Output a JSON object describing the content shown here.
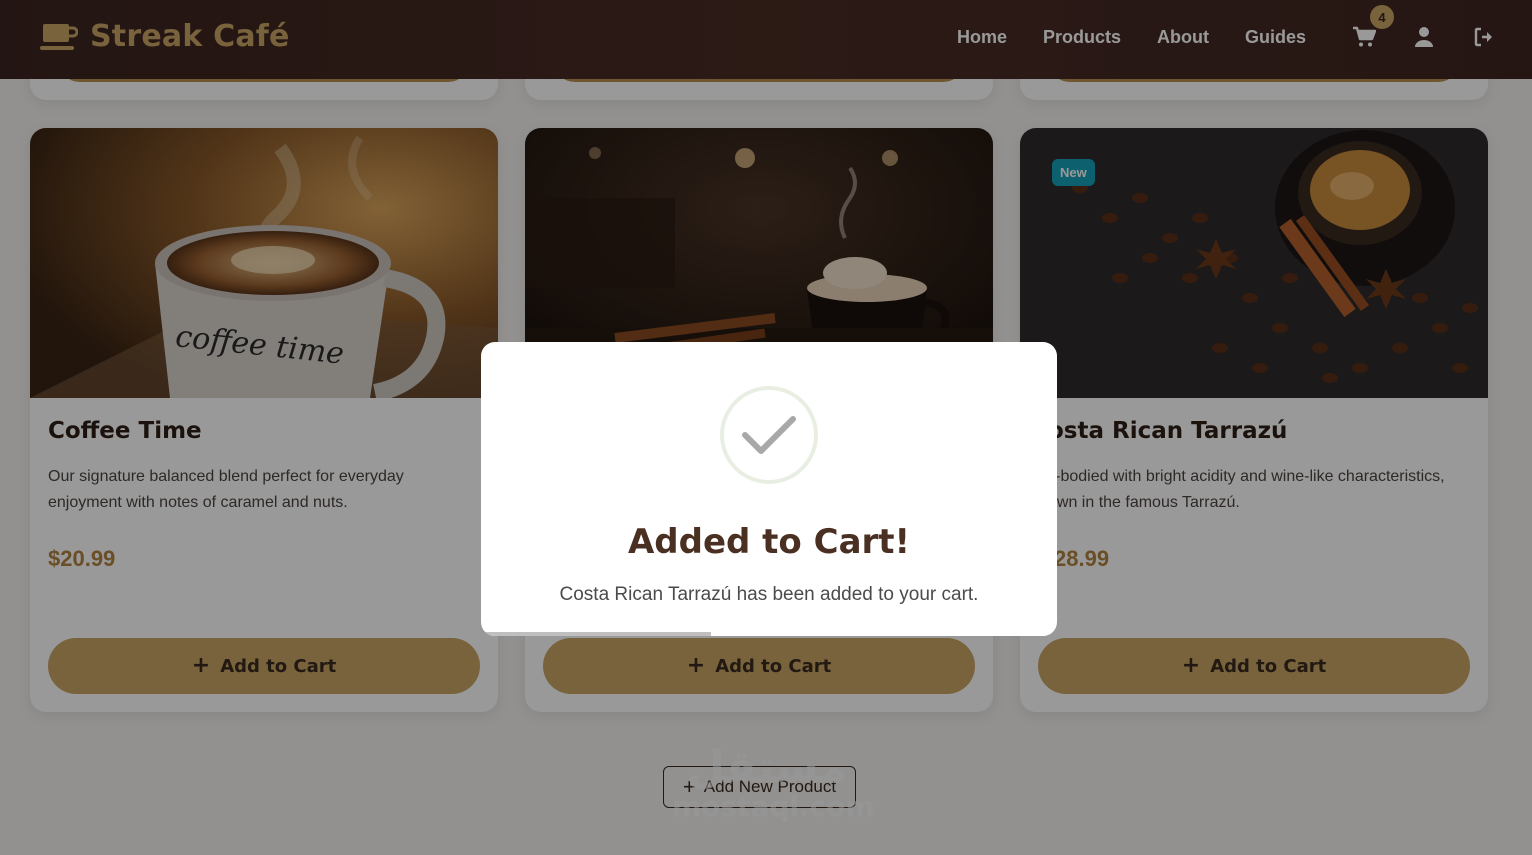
{
  "brand": {
    "name": "Streak Café",
    "icon": "coffee-cup-icon",
    "color": "#c9a565"
  },
  "nav": {
    "links": [
      "Home",
      "Products",
      "About",
      "Guides"
    ],
    "cart_count": "4",
    "icons": [
      "cart-icon",
      "user-icon",
      "logout-icon"
    ]
  },
  "products": [
    {
      "title": "Coffee Time",
      "description": "Our signature balanced blend perfect for everyday enjoyment with notes of caramel and nuts.",
      "price": "$20.99",
      "button": "Add to Cart",
      "badge": ""
    },
    {
      "title": "",
      "description": "",
      "price": "",
      "button": "Add to Cart",
      "badge": ""
    },
    {
      "title": "osta Rican Tarrazú",
      "description": "ll-bodied with bright acidity and wine-like characteristics, own in the famous Tarrazú.",
      "description_lines": [
        "ll-bodied with bright acidity and wine-like characteristics,",
        "own in the famous Tarrazú."
      ],
      "price": "28.99",
      "button": "Add to Cart",
      "badge": "New"
    }
  ],
  "add_new_product": "Add New Product",
  "watermark": {
    "arabic": "مستقل",
    "latin": "mostaql.com"
  },
  "modal": {
    "title": "Added to Cart!",
    "message": "Costa Rican Tarrazú has been added to your cart.",
    "icon": "checkmark-icon",
    "timer_progress": 0.4
  },
  "colors": {
    "header_bg": "#3e2622",
    "accent": "#c9a565",
    "price": "#b08340",
    "badge_new": "#17a2b8"
  }
}
